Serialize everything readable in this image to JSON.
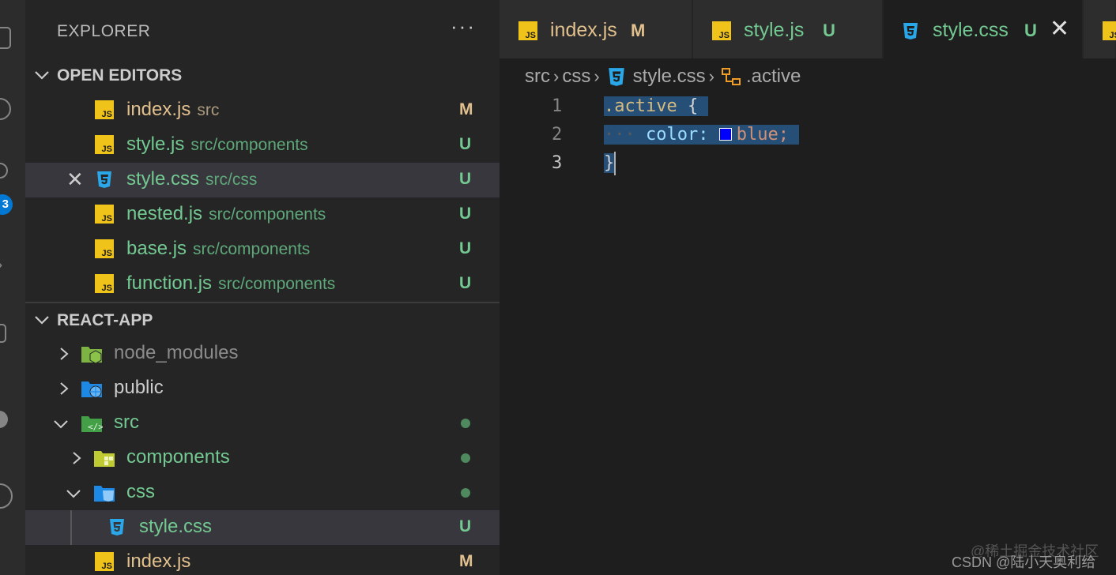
{
  "activity_bar": {
    "icons": [
      "explorer-icon",
      "search-icon",
      "source-control-icon",
      "run-debug-icon",
      "extensions-icon",
      "account-icon",
      "remote-icon"
    ],
    "badge": "3"
  },
  "sidebar": {
    "title": "EXPLORER",
    "more_label": "···",
    "open_editors": {
      "label": "OPEN EDITORS",
      "items": [
        {
          "name": "index.js",
          "desc": "src",
          "status": "M",
          "icon": "js-icon"
        },
        {
          "name": "style.js",
          "desc": "src/components",
          "status": "U",
          "icon": "js-icon"
        },
        {
          "name": "style.css",
          "desc": "src/css",
          "status": "U",
          "icon": "css-icon",
          "close": "✕"
        },
        {
          "name": "nested.js",
          "desc": "src/components",
          "status": "U",
          "icon": "js-icon"
        },
        {
          "name": "base.js",
          "desc": "src/components",
          "status": "U",
          "icon": "js-icon"
        },
        {
          "name": "function.js",
          "desc": "src/components",
          "status": "U",
          "icon": "js-icon"
        }
      ]
    },
    "project": {
      "label": "REACT-APP",
      "tree": [
        {
          "name": "node_modules",
          "icon": "node-folder-icon"
        },
        {
          "name": "public",
          "icon": "public-folder-icon"
        },
        {
          "name": "src",
          "icon": "src-folder-icon"
        },
        {
          "name": "components",
          "icon": "components-folder-icon"
        },
        {
          "name": "css",
          "icon": "css-folder-icon"
        },
        {
          "name": "style.css",
          "icon": "css-icon",
          "status": "U"
        },
        {
          "name": "index.js",
          "icon": "js-icon",
          "status": "M"
        }
      ]
    }
  },
  "editor": {
    "tabs": [
      {
        "name": "index.js",
        "status": "M",
        "icon": "js-icon"
      },
      {
        "name": "style.js",
        "status": "U",
        "icon": "js-icon"
      },
      {
        "name": "style.css",
        "status": "U",
        "icon": "css-icon",
        "close": "✕"
      }
    ],
    "breadcrumb": [
      "src",
      "css",
      "style.css",
      ".active"
    ],
    "lines": [
      {
        "number": "1",
        "selector": ".active",
        "open_brace": "{"
      },
      {
        "number": "2",
        "indent": "···",
        "property": "color:",
        "value": "blue;"
      },
      {
        "number": "3",
        "close_brace": "}"
      }
    ]
  },
  "watermark": {
    "line1": "@稀土掘金技术社区",
    "line2": "CSDN @陆小天奥利给"
  },
  "colors": {
    "modified": "#e2c08d",
    "untracked": "#73c991",
    "selection": "#264f78",
    "swatch_blue": "#0000ff",
    "badge": "#0078d4"
  }
}
